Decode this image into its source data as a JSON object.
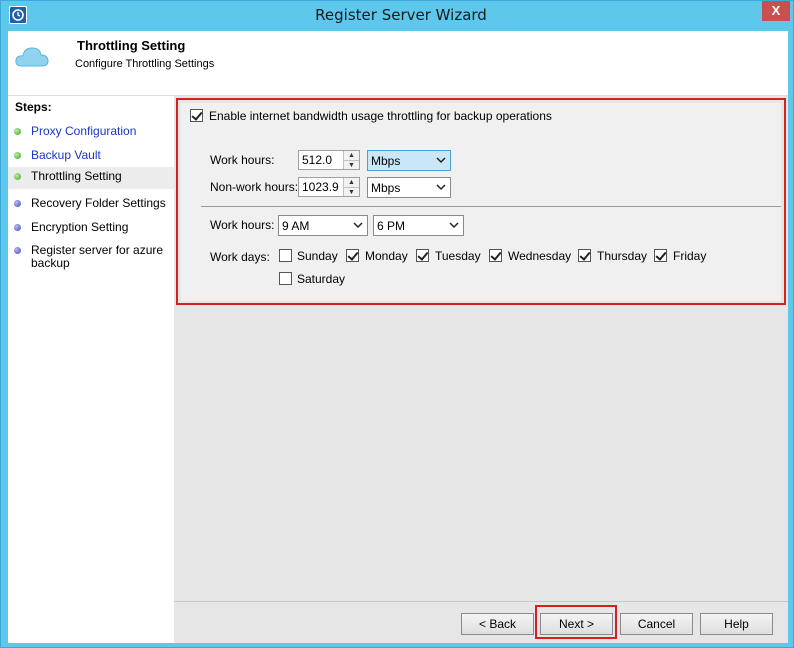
{
  "window": {
    "title": "Register Server Wizard",
    "close_glyph": "X"
  },
  "header": {
    "title": "Throttling Setting",
    "subtitle": "Configure Throttling Settings"
  },
  "sidebar": {
    "label": "Steps:",
    "items": [
      {
        "label": "Proxy Configuration",
        "status": "done"
      },
      {
        "label": "Backup Vault",
        "status": "done"
      },
      {
        "label": "Throttling Setting",
        "status": "current"
      },
      {
        "label": "Recovery Folder Settings",
        "status": "todo"
      },
      {
        "label": "Encryption Setting",
        "status": "todo"
      },
      {
        "label": "Register server for azure backup",
        "status": "todo"
      }
    ]
  },
  "throttle": {
    "enable_label": "Enable internet bandwidth usage throttling for backup operations",
    "enable_checked": true,
    "work_hours_label": "Work hours:",
    "work_hours_value": "512.0",
    "work_hours_unit": "Mbps",
    "nonwork_hours_label": "Non-work hours:",
    "nonwork_hours_value": "1023.9",
    "nonwork_hours_unit": "Mbps",
    "schedule_label": "Work hours:",
    "start_time": "9 AM",
    "end_time": "6 PM",
    "work_days_label": "Work days:",
    "days": [
      {
        "label": "Sunday",
        "checked": false
      },
      {
        "label": "Monday",
        "checked": true
      },
      {
        "label": "Tuesday",
        "checked": true
      },
      {
        "label": "Wednesday",
        "checked": true
      },
      {
        "label": "Thursday",
        "checked": true
      },
      {
        "label": "Friday",
        "checked": true
      },
      {
        "label": "Saturday",
        "checked": false
      }
    ]
  },
  "buttons": {
    "back": "< Back",
    "next": "Next >",
    "cancel": "Cancel",
    "help": "Help"
  },
  "colors": {
    "titlebar": "#5ec7ec",
    "highlight": "#d42020",
    "link": "#1a37c8"
  }
}
